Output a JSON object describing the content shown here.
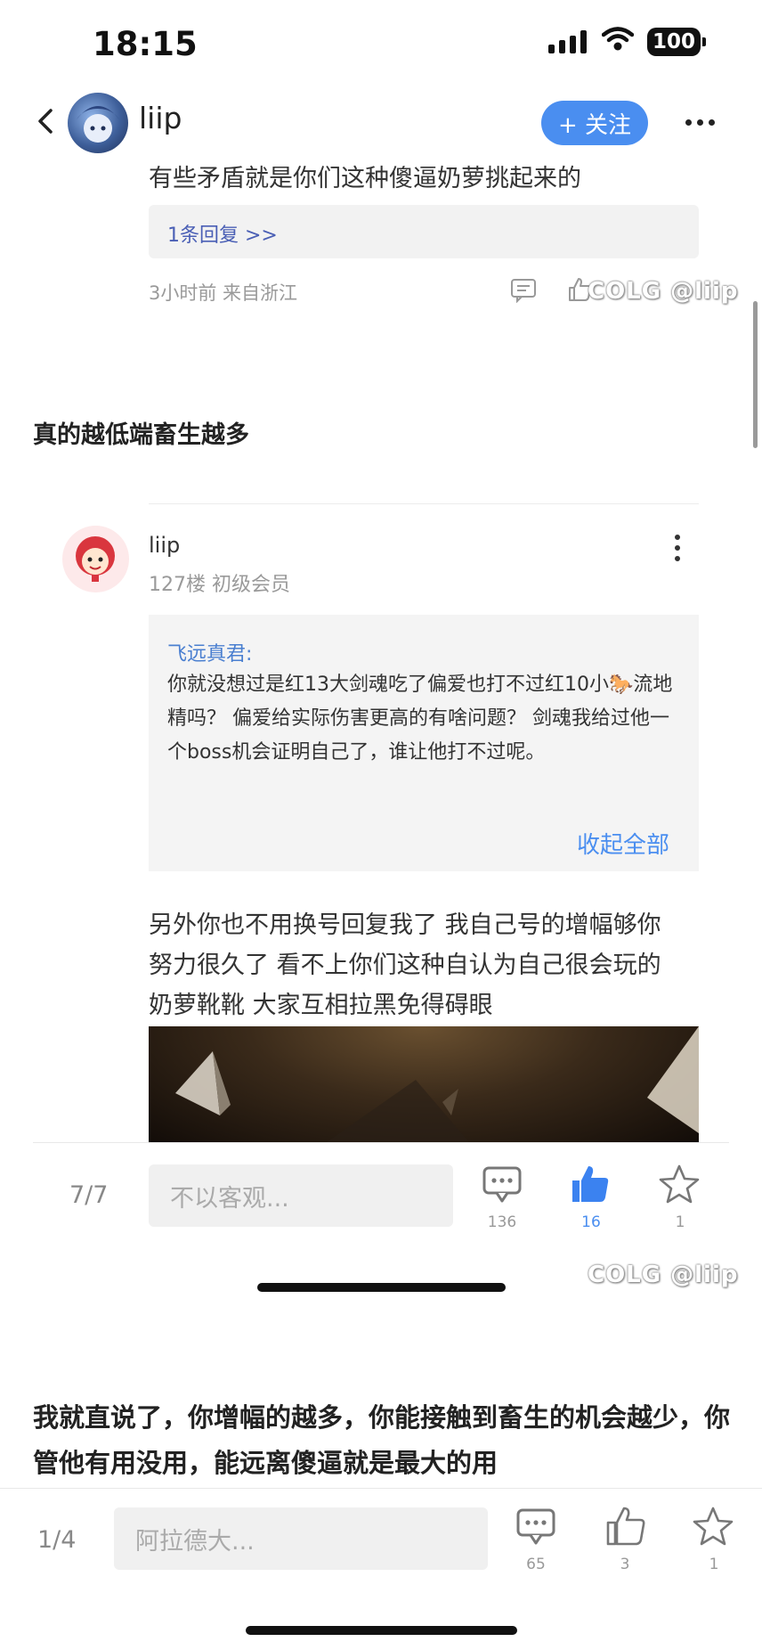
{
  "status_bar": {
    "time": "18:15",
    "battery": "100"
  },
  "header": {
    "username": "liip",
    "follow_label": "+ 关注"
  },
  "prev_comment": {
    "text": "有些矛盾就是你们这种傻逼奶萝挑起来的",
    "reply_link": "1条回复 >>",
    "meta": "3小时前 来自浙江"
  },
  "watermark": "COLG @liip",
  "section_1": {
    "title": "真的越低端畜生越多"
  },
  "reply_post": {
    "username": "liip",
    "floor_info": "127楼 初级会员",
    "quote": {
      "author": "飞远真君:",
      "text": "你就没想过是红13大剑魂吃了偏爱也打不过红10小🐎流地精吗？ 偏爱给实际伤害更高的有啥问题？ 剑魂我给过他一个boss机会证明自己了，谁让他打不过呢。",
      "collapse_label": "收起全部"
    },
    "body": "另外你也不用换号回复我了 我自己号的增幅够你努力很久了 看不上你们这种自认为自己很会玩的奶萝靴靴 大家互相拉黑免得碍眼"
  },
  "bottom_bar_1": {
    "page": "7/7",
    "input_placeholder": "不以客观...",
    "comment_count": "136",
    "like_count": "16",
    "star_count": "1"
  },
  "section_2": {
    "title": "我就直说了，你增幅的越多，你能接触到畜生的机会越少，你管他有用没用，能远离傻逼就是最大的用"
  },
  "bottom_bar_2": {
    "page": "1/4",
    "input_placeholder": "阿拉德大...",
    "comment_count": "65",
    "like_count": "3",
    "star_count": "1"
  },
  "colors": {
    "accent": "#4a8ef0",
    "link": "#4a5fb5",
    "meta": "#9a9a9a"
  }
}
